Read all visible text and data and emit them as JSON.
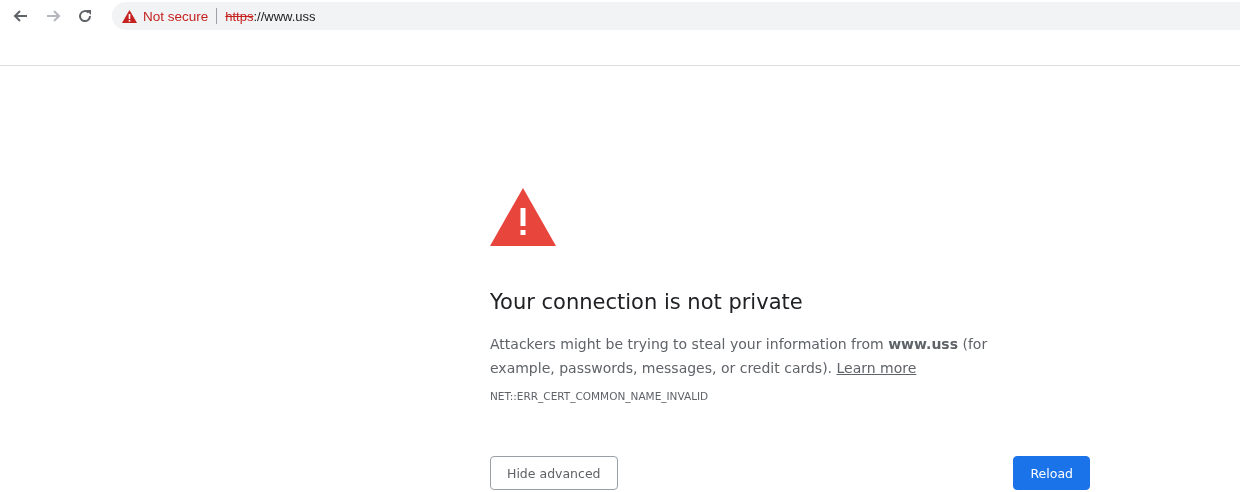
{
  "toolbar": {
    "back_enabled": true,
    "forward_enabled": false,
    "security_label": "Not secure",
    "url_scheme": "https",
    "url_rest": "://www.uss"
  },
  "interstitial": {
    "title": "Your connection is not private",
    "body": "Attackers might be trying to steal your information from **www.uss** (for example, passwords, messages, or credit cards).",
    "link": "Learn more",
    "error_code": "NET::ERR_CERT_COMMON_NAME_INVALID"
  },
  "buttons": [
    {
      "label": "Hide advanced",
      "kind": "secondary"
    },
    {
      "label": "Reload",
      "kind": "primary"
    }
  ]
}
